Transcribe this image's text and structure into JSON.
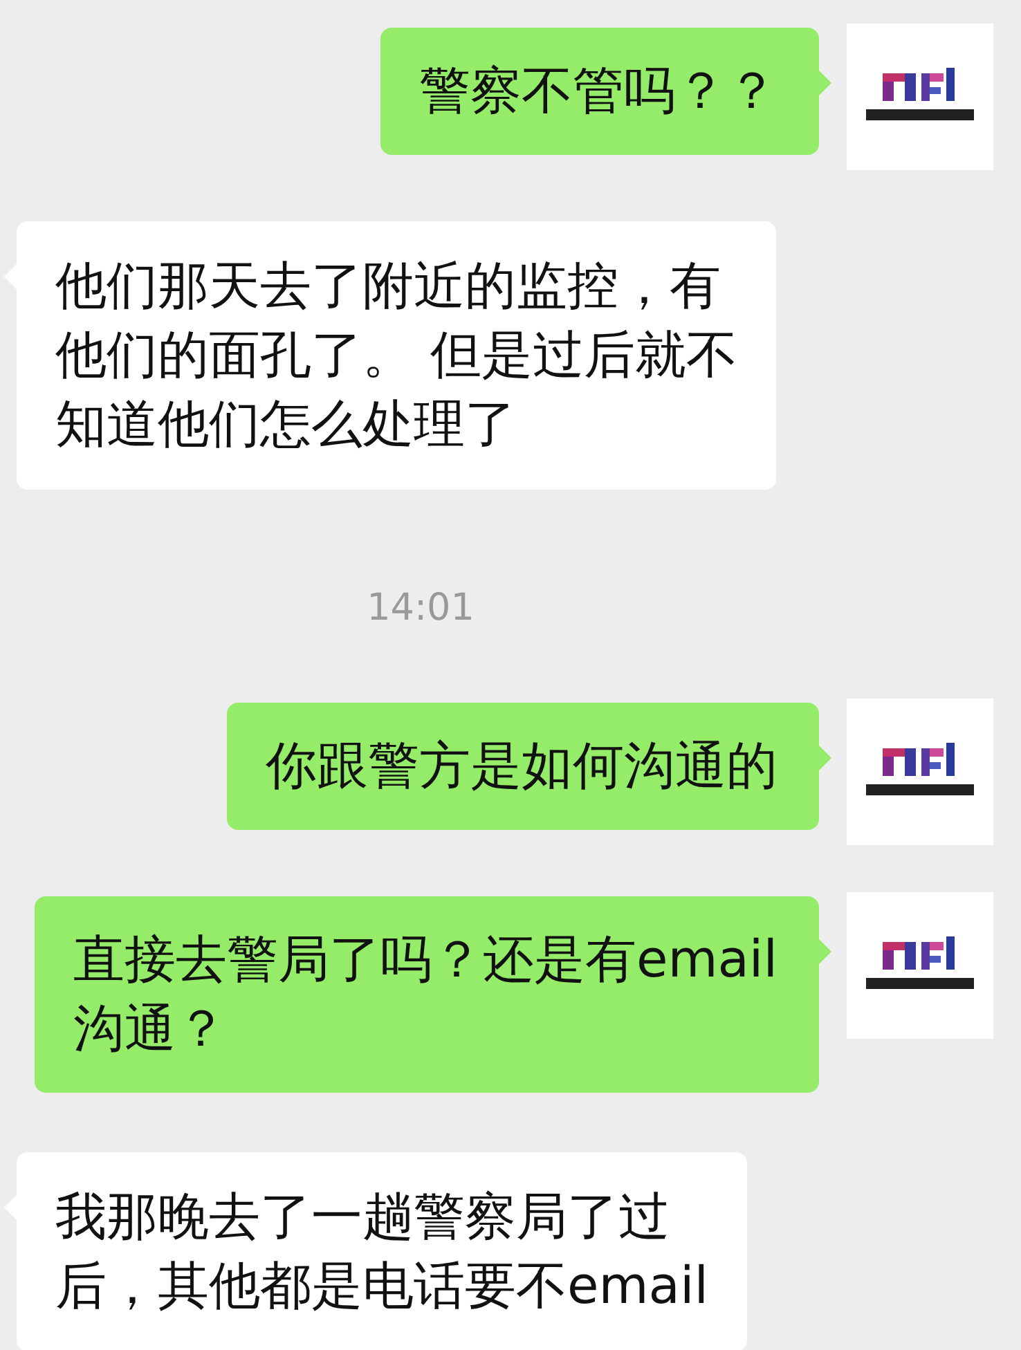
{
  "messages": [
    {
      "kind": "sent",
      "lines": [
        "警察不管吗？？"
      ]
    },
    {
      "kind": "received",
      "lines": [
        "他们那天去了附近的监控，有",
        "他们的面孔了。 但是过后就不",
        "知道他们怎么处理了"
      ]
    },
    {
      "kind": "time",
      "lines": [
        "14:01"
      ]
    },
    {
      "kind": "sent",
      "lines": [
        "你跟警方是如何沟通的"
      ]
    },
    {
      "kind": "sent",
      "lines": [
        "直接去警局了吗？还是有email",
        "沟通？"
      ]
    },
    {
      "kind": "received",
      "lines": [
        "我那晚去了一趟警察局了过",
        "后，其他都是电话要不email"
      ]
    }
  ]
}
